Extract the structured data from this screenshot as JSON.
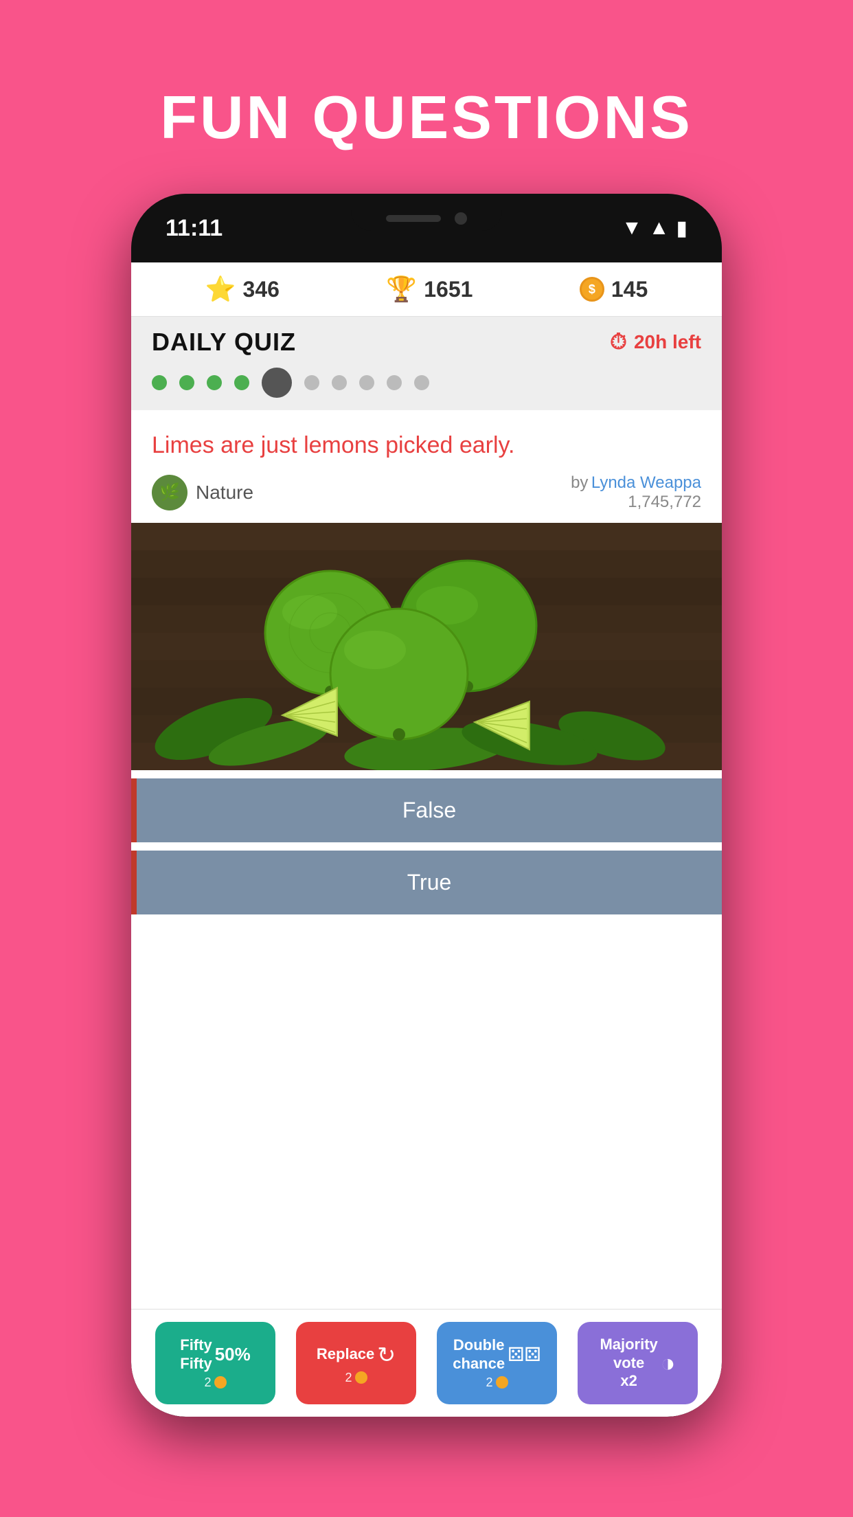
{
  "page": {
    "title": "FUN QUESTIONS",
    "background_color": "#F9548A"
  },
  "phone": {
    "time": "11:11",
    "stats": {
      "star_value": "346",
      "trophy_value": "1651",
      "coin_value": "145"
    },
    "daily_quiz": {
      "title": "DAILY QUIZ",
      "timer": "20h left",
      "progress_dots": [
        "filled",
        "filled",
        "filled",
        "filled",
        "current",
        "empty",
        "empty",
        "empty",
        "empty",
        "empty"
      ]
    },
    "question": {
      "text": "Limes are just lemons picked early.",
      "category": "Nature",
      "author_prefix": "by",
      "author_name": "Lynda Weappa",
      "author_score": "1,745,772"
    },
    "answers": [
      {
        "label": "False",
        "id": "false-btn"
      },
      {
        "label": "True",
        "id": "true-btn"
      }
    ],
    "powerups": [
      {
        "id": "fifty-fifty",
        "label": "Fifty\nFifty",
        "icon": "50%",
        "cost": "2",
        "color": "#1BAD8B"
      },
      {
        "id": "replace",
        "label": "Replace",
        "icon": "↻",
        "cost": "2",
        "color": "#E84040"
      },
      {
        "id": "double-chance",
        "label": "Double\nchance",
        "icon": "⚄⚄",
        "cost": "2",
        "color": "#4A90D9"
      },
      {
        "id": "majority-vote",
        "label": "Majority\nvote\nx2",
        "icon": "◑",
        "cost": "",
        "color": "#8A6FD8"
      }
    ]
  }
}
